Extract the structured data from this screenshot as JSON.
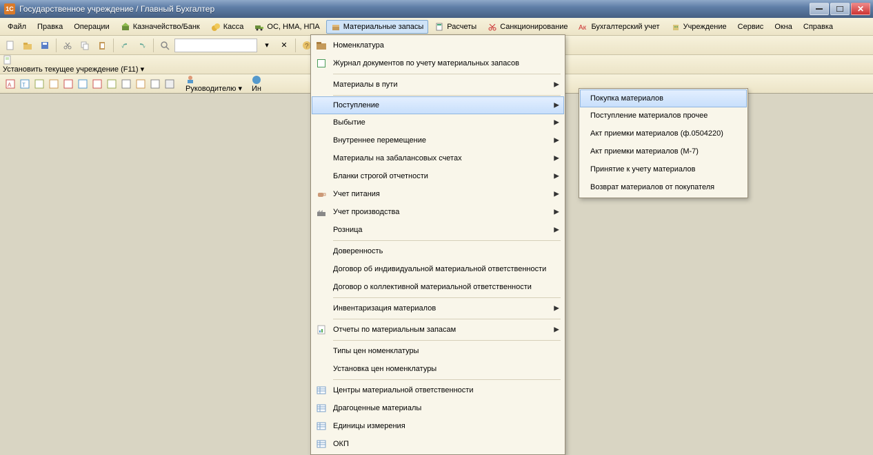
{
  "titlebar": {
    "app_icon_text": "1С",
    "title": "Государственное учреждение / Главный Бухгалтер"
  },
  "menubar": {
    "file": "Файл",
    "edit": "Правка",
    "operations": "Операции",
    "treasury": "Казначейство/Банк",
    "cashier": "Касса",
    "os": "ОС, НМА, НПА",
    "materials": "Материальные запасы",
    "calculations": "Расчеты",
    "sanction": "Санкционирование",
    "accounting": "Бухгалтерский учет",
    "institution": "Учреждение",
    "service": "Сервис",
    "windows": "Окна",
    "help": "Справка"
  },
  "toolbar2": {
    "set_institution": "Установить текущее учреждение (F11)"
  },
  "toolbar3": {
    "manager": "Руководителю",
    "info_prefix": "Ин"
  },
  "materials_menu": {
    "items": [
      {
        "label": "Номенклатура",
        "icon": "folder-brown"
      },
      {
        "label": "Журнал документов по учету материальных запасов",
        "icon": "book-green"
      },
      {
        "label": "Материалы в пути",
        "submenu": true
      },
      {
        "label": "Поступление",
        "submenu": true,
        "highlight": true
      },
      {
        "label": "Выбытие",
        "submenu": true
      },
      {
        "label": "Внутреннее перемещение",
        "submenu": true
      },
      {
        "label": "Материалы на забалансовых счетах",
        "submenu": true
      },
      {
        "label": "Бланки строгой отчетности",
        "submenu": true
      },
      {
        "label": "Учет питания",
        "submenu": true,
        "icon": "cup"
      },
      {
        "label": "Учет производства",
        "submenu": true,
        "icon": "factory"
      },
      {
        "label": "Розница",
        "submenu": true
      },
      {
        "label": "Доверенность"
      },
      {
        "label": "Договор об индивидуальной материальной ответственности"
      },
      {
        "label": "Договор о коллективной материальной ответственности"
      },
      {
        "label": "Инвентаризация материалов",
        "submenu": true
      },
      {
        "label": "Отчеты по материальным запасам",
        "submenu": true,
        "icon": "report"
      },
      {
        "label": "Типы цен номенклатуры"
      },
      {
        "label": "Установка цен номенклатуры"
      },
      {
        "label": "Центры материальной ответственности",
        "icon": "list"
      },
      {
        "label": "Драгоценные материалы",
        "icon": "list"
      },
      {
        "label": "Единицы измерения",
        "icon": "list"
      },
      {
        "label": "ОКП",
        "icon": "list"
      }
    ]
  },
  "postuplenie_submenu": {
    "items": [
      {
        "label": "Покупка материалов",
        "highlight": true
      },
      {
        "label": "Поступление материалов прочее"
      },
      {
        "divider": true
      },
      {
        "label": "Акт приемки материалов (ф.0504220)"
      },
      {
        "label": "Акт приемки материалов (М-7)"
      },
      {
        "divider": true
      },
      {
        "label": "Принятие к учету материалов"
      },
      {
        "divider": true
      },
      {
        "label": "Возврат материалов от покупателя"
      }
    ]
  }
}
